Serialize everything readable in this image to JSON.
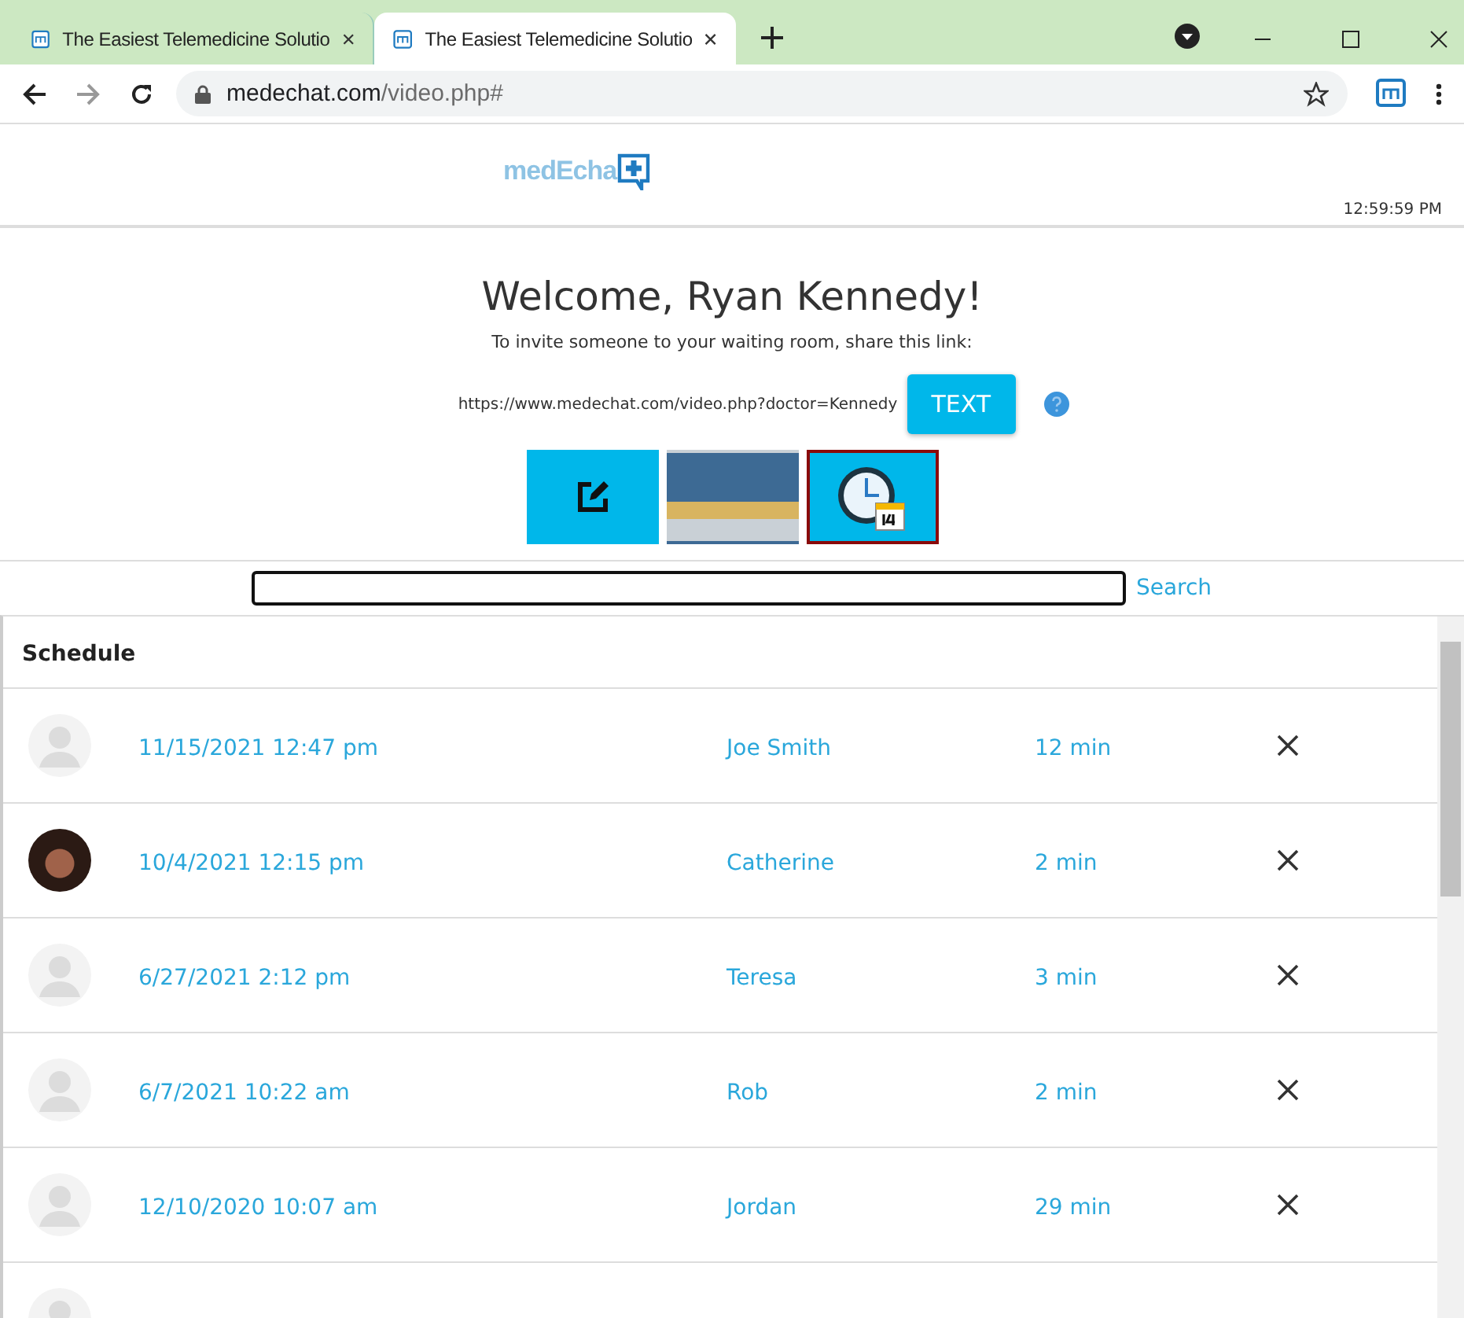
{
  "browser": {
    "tabs": [
      {
        "title": "The Easiest Telemedicine Solutio",
        "selected": false
      },
      {
        "title": "The Easiest Telemedicine Solutio",
        "selected": true
      }
    ],
    "url_host": "medechat.com",
    "url_path": "/video.php#"
  },
  "header": {
    "logo": "medEcha",
    "time": "12:59:59 PM"
  },
  "welcome": {
    "title": "Welcome, Ryan Kennedy!",
    "subtitle": "To invite someone to your waiting room, share this link:",
    "link": "https://www.medechat.com/video.php?doctor=Kennedy",
    "text_button": "TEXT"
  },
  "tiles": [
    {
      "kind": "edit",
      "selected": false
    },
    {
      "kind": "waiting-room",
      "selected": false
    },
    {
      "kind": "schedule",
      "selected": true
    }
  ],
  "search": {
    "button": "Search"
  },
  "schedule": {
    "title": "Schedule",
    "rows": [
      {
        "kind": "placeholder",
        "date": "11/15/2021 12:47 pm",
        "name": "Joe Smith",
        "duration": "12 min"
      },
      {
        "kind": "photo",
        "date": "10/4/2021 12:15 pm",
        "name": "Catherine",
        "duration": "2 min"
      },
      {
        "kind": "placeholder",
        "date": "6/27/2021 2:12 pm",
        "name": "Teresa",
        "duration": "3 min"
      },
      {
        "kind": "placeholder",
        "date": "6/7/2021 10:22 am",
        "name": "Rob",
        "duration": "2 min"
      },
      {
        "kind": "placeholder",
        "date": "12/10/2020 10:07 am",
        "name": "Jordan",
        "duration": "29 min"
      },
      {
        "kind": "placeholder"
      }
    ]
  }
}
